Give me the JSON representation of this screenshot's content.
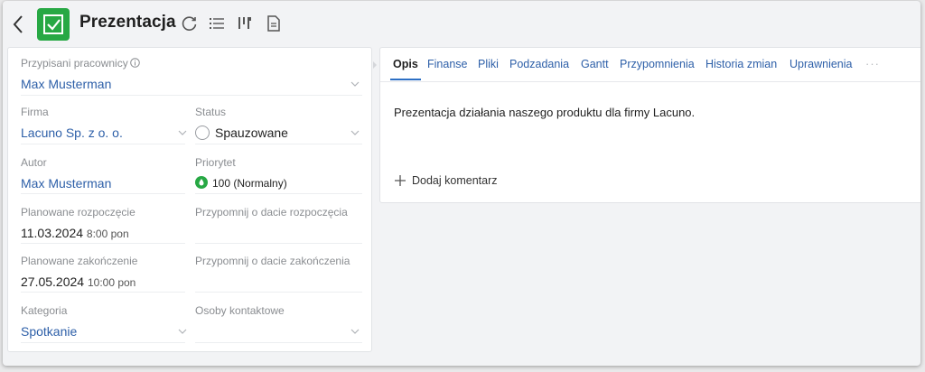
{
  "header": {
    "title": "Prezentacja",
    "icons": [
      "back-icon",
      "task-check-icon",
      "refresh-icon",
      "list-icon",
      "hierarchy-icon",
      "document-icon"
    ],
    "accent": "#27a844"
  },
  "fields": {
    "assigned": {
      "label": "Przypisani pracownicy",
      "value": "Max Musterman"
    },
    "company": {
      "label": "Firma",
      "value": "Lacuno Sp. z o. o."
    },
    "status": {
      "label": "Status",
      "value": "Spauzowane"
    },
    "author": {
      "label": "Autor",
      "value": "Max Musterman"
    },
    "priority": {
      "label": "Priorytet",
      "value": "100 (Normalny)"
    },
    "planned_start": {
      "label": "Planowane rozpoczęcie",
      "date": "11.03.2024",
      "time": "8:00 pon"
    },
    "remind_start": {
      "label": "Przypomnij o dacie rozpoczęcia"
    },
    "planned_end": {
      "label": "Planowane zakończenie",
      "date": "27.05.2024",
      "time": "10:00 pon"
    },
    "remind_end": {
      "label": "Przypomnij o dacie zakończenia"
    },
    "category": {
      "label": "Kategoria",
      "value": "Spotkanie"
    },
    "contacts": {
      "label": "Osoby kontaktowe"
    }
  },
  "tabs": [
    {
      "label": "Opis",
      "active": true
    },
    {
      "label": "Finanse"
    },
    {
      "label": "Pliki"
    },
    {
      "label": "Podzadania"
    },
    {
      "label": "Gantt"
    },
    {
      "label": "Przypomnienia"
    },
    {
      "label": "Historia zmian"
    },
    {
      "label": "Uprawnienia"
    }
  ],
  "tabs_more": "···",
  "description": "Prezentacja działania naszego produktu dla firmy Lacuno.",
  "add_comment": "Dodaj komentarz",
  "colors": {
    "link": "#2d5fa8",
    "priority": "#27a844",
    "tab_underline": "#2d6fc4"
  }
}
